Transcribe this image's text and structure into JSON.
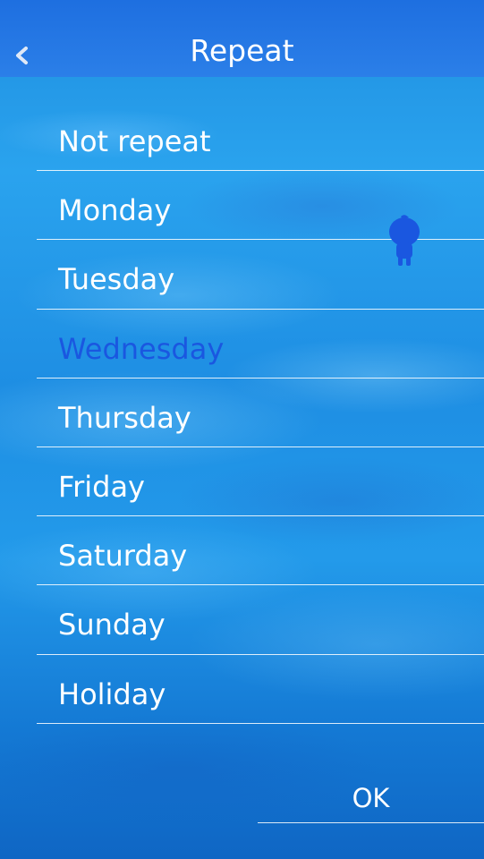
{
  "header": {
    "title": "Repeat",
    "back_icon": "chevron-left-icon"
  },
  "options": [
    {
      "label": "Not repeat",
      "selected": false
    },
    {
      "label": "Monday",
      "selected": false
    },
    {
      "label": "Tuesday",
      "selected": false
    },
    {
      "label": "Wednesday",
      "selected": true
    },
    {
      "label": "Thursday",
      "selected": false
    },
    {
      "label": "Friday",
      "selected": false
    },
    {
      "label": "Saturday",
      "selected": false
    },
    {
      "label": "Sunday",
      "selected": false
    },
    {
      "label": "Holiday",
      "selected": false
    }
  ],
  "selected_indicator_icon": "character-icon",
  "ok_label": "OK",
  "colors": {
    "header": "#2b7fe8",
    "selected_text": "#1a57e0",
    "text": "#ffffff",
    "indicator": "#1a57e0"
  }
}
